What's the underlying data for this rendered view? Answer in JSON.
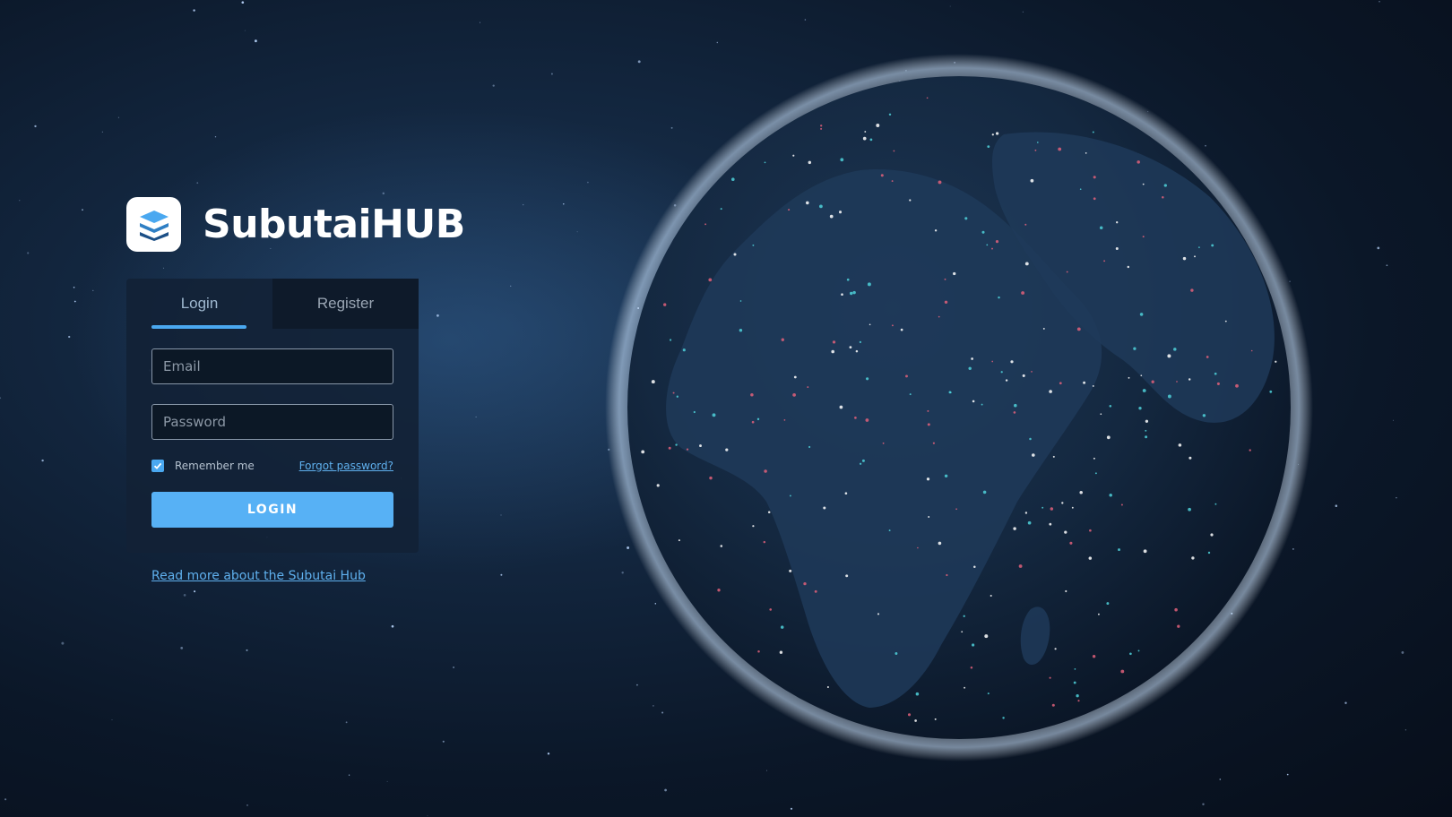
{
  "brand": {
    "name": "SubutaiHUB",
    "logo_icon": "stacked-layers-icon",
    "accent_color": "#4aa8f0"
  },
  "auth": {
    "tabs": [
      {
        "label": "Login",
        "active": true
      },
      {
        "label": "Register",
        "active": false
      }
    ],
    "email_placeholder": "Email",
    "password_placeholder": "Password",
    "remember_label": "Remember me",
    "remember_checked": true,
    "forgot_label": "Forgot password?",
    "login_label": "LOGIN"
  },
  "footer": {
    "read_more_label": "Read more about the Subutai Hub"
  },
  "globe": {
    "icon": "earth-globe-illustration",
    "dot_colors": [
      "#ffffff",
      "#4fd1d9",
      "#e0607a"
    ]
  }
}
